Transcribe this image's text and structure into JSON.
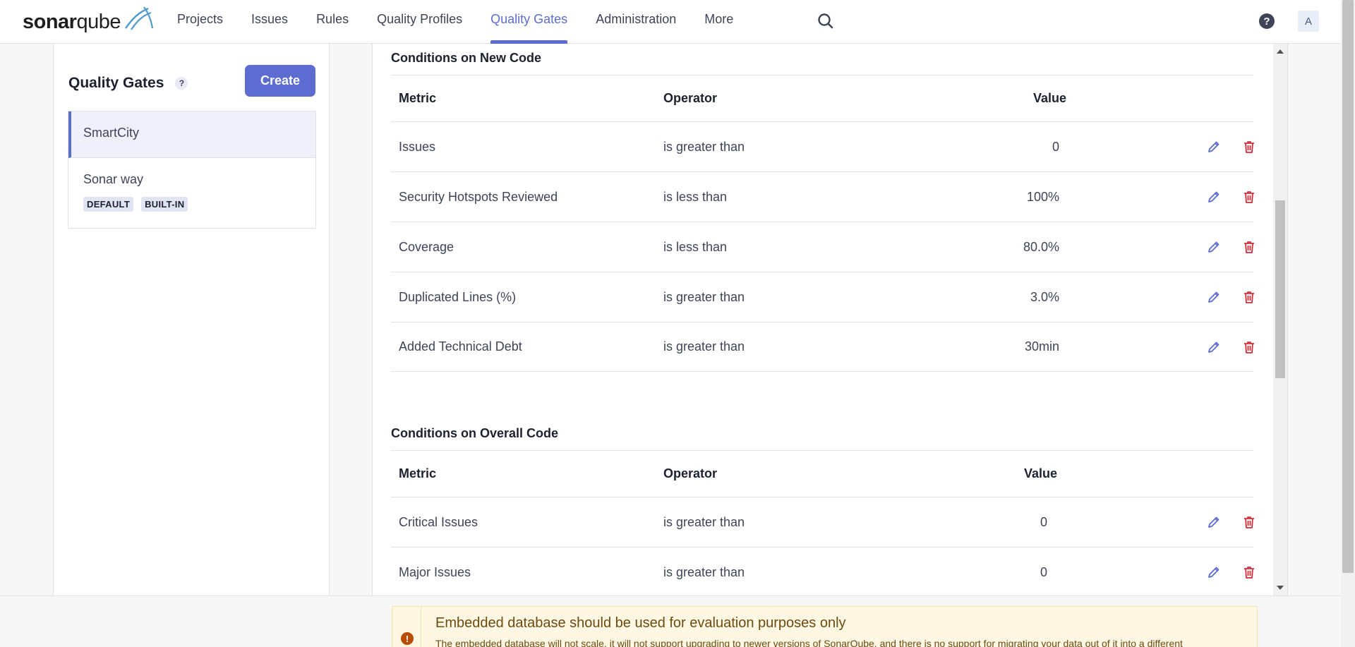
{
  "brand": {
    "part1": "sonar",
    "part2": "qube"
  },
  "nav": {
    "items": [
      {
        "label": "Projects",
        "active": false
      },
      {
        "label": "Issues",
        "active": false
      },
      {
        "label": "Rules",
        "active": false
      },
      {
        "label": "Quality Profiles",
        "active": false
      },
      {
        "label": "Quality Gates",
        "active": true
      },
      {
        "label": "Administration",
        "active": false
      },
      {
        "label": "More",
        "active": false
      }
    ],
    "search_icon": "search-icon",
    "help_label": "?",
    "avatar_initial": "A"
  },
  "sidebar": {
    "title": "Quality Gates",
    "help_label": "?",
    "create_label": "Create",
    "gates": [
      {
        "name": "SmartCity",
        "selected": true,
        "badges": []
      },
      {
        "name": "Sonar way",
        "selected": false,
        "badges": [
          "DEFAULT",
          "BUILT-IN"
        ]
      }
    ]
  },
  "main": {
    "new_code": {
      "title": "Conditions on New Code",
      "headers": {
        "metric": "Metric",
        "operator": "Operator",
        "value": "Value"
      },
      "rows": [
        {
          "metric": "Issues",
          "operator": "is greater than",
          "value": "0"
        },
        {
          "metric": "Security Hotspots Reviewed",
          "operator": "is less than",
          "value": "100%"
        },
        {
          "metric": "Coverage",
          "operator": "is less than",
          "value": "80.0%"
        },
        {
          "metric": "Duplicated Lines (%)",
          "operator": "is greater than",
          "value": "3.0%"
        },
        {
          "metric": "Added Technical Debt",
          "operator": "is greater than",
          "value": "30min"
        }
      ]
    },
    "overall_code": {
      "title": "Conditions on Overall Code",
      "headers": {
        "metric": "Metric",
        "operator": "Operator",
        "value": "Value"
      },
      "rows": [
        {
          "metric": "Critical Issues",
          "operator": "is greater than",
          "value": "0"
        },
        {
          "metric": "Major Issues",
          "operator": "is greater than",
          "value": "0"
        }
      ]
    }
  },
  "footer": {
    "warning_title": "Embedded database should be used for evaluation purposes only",
    "warning_text": "The embedded database will not scale, it will not support upgrading to newer versions of SonarQube, and there is no support for migrating your data out of it into a different",
    "warning_icon_label": "!"
  },
  "colors": {
    "accent": "#5d6cd0",
    "danger": "#d02f3a",
    "warning_bg": "#fef7e3"
  }
}
